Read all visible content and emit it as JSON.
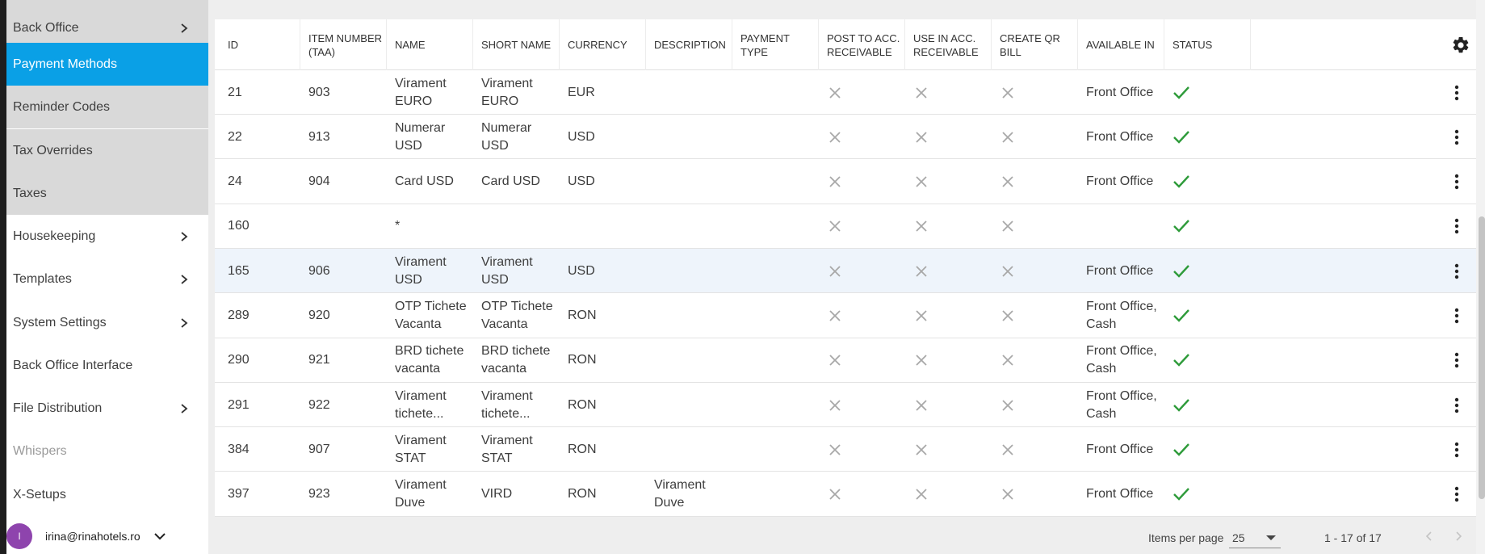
{
  "sidebar": {
    "items": [
      {
        "label": "Back Office",
        "chevron": true
      },
      {
        "label": "Payment Methods",
        "chevron": false
      },
      {
        "label": "Reminder Codes",
        "chevron": false
      },
      {
        "label": "Tax Overrides",
        "chevron": false
      },
      {
        "label": "Taxes",
        "chevron": false
      },
      {
        "label": "Housekeeping",
        "chevron": true
      },
      {
        "label": "Templates",
        "chevron": true
      },
      {
        "label": "System Settings",
        "chevron": true
      },
      {
        "label": "Back Office Interface",
        "chevron": false
      },
      {
        "label": "File Distribution",
        "chevron": true
      },
      {
        "label": "Whispers",
        "chevron": false
      },
      {
        "label": "X-Setups",
        "chevron": false
      }
    ],
    "user": {
      "initial": "I",
      "email": "irina@rinahotels.ro"
    }
  },
  "table": {
    "headers": {
      "id": "ID",
      "item_number": "ITEM NUMBER (TAA)",
      "name": "NAME",
      "short_name": "SHORT NAME",
      "currency": "CURRENCY",
      "description": "DESCRIPTION",
      "payment_type": "PAYMENT TYPE",
      "post_to_acc": "POST TO ACC. RECEIVABLE",
      "use_in_acc": "USE IN ACC. RECEIVABLE",
      "create_qr": "CREATE QR BILL",
      "available_in": "AVAILABLE IN",
      "status": "STATUS"
    },
    "rows": [
      {
        "id": "21",
        "item_number": "903",
        "name": "Virament EURO",
        "short_name": "Virament EURO",
        "currency": "EUR",
        "description": "",
        "payment_type": "",
        "available_in": "Front Office"
      },
      {
        "id": "22",
        "item_number": "913",
        "name": "Numerar USD",
        "short_name": "Numerar USD",
        "currency": "USD",
        "description": "",
        "payment_type": "",
        "available_in": "Front Office"
      },
      {
        "id": "24",
        "item_number": "904",
        "name": "Card USD",
        "short_name": "Card USD",
        "currency": "USD",
        "description": "",
        "payment_type": "",
        "available_in": "Front Office"
      },
      {
        "id": "160",
        "item_number": "",
        "name": "*",
        "short_name": "",
        "currency": "",
        "description": "",
        "payment_type": "",
        "available_in": ""
      },
      {
        "id": "165",
        "item_number": "906",
        "name": "Virament USD",
        "short_name": "Virament USD",
        "currency": "USD",
        "description": "",
        "payment_type": "",
        "available_in": "Front Office"
      },
      {
        "id": "289",
        "item_number": "920",
        "name": "OTP Tichete Vacanta",
        "short_name": "OTP Tichete Vacanta",
        "currency": "RON",
        "description": "",
        "payment_type": "",
        "available_in": "Front Office, Cash"
      },
      {
        "id": "290",
        "item_number": "921",
        "name": "BRD tichete vacanta",
        "short_name": "BRD tichete vacanta",
        "currency": "RON",
        "description": "",
        "payment_type": "",
        "available_in": "Front Office, Cash"
      },
      {
        "id": "291",
        "item_number": "922",
        "name": "Virament tichete...",
        "short_name": "Virament tichete...",
        "currency": "RON",
        "description": "",
        "payment_type": "",
        "available_in": "Front Office, Cash"
      },
      {
        "id": "384",
        "item_number": "907",
        "name": "Virament STAT",
        "short_name": "Virament STAT",
        "currency": "RON",
        "description": "",
        "payment_type": "",
        "available_in": "Front Office"
      },
      {
        "id": "397",
        "item_number": "923",
        "name": "Virament Duve",
        "short_name": "VIRD",
        "currency": "RON",
        "description": "Virament Duve",
        "payment_type": "",
        "available_in": "Front Office"
      }
    ]
  },
  "footer": {
    "items_per_page_label": "Items per page",
    "items_per_page_value": "25",
    "range": "1 - 17 of 17"
  },
  "colors": {
    "accent": "#0aa0e6",
    "check": "#2e9b3a",
    "x_icon": "#a8a8a8",
    "avatar": "#8e44ad",
    "row_highlight": "#eef4fb"
  },
  "icons": {
    "settings": "gear-icon",
    "more": "more-vert-icon",
    "yes": "check-icon",
    "no": "close-icon"
  }
}
